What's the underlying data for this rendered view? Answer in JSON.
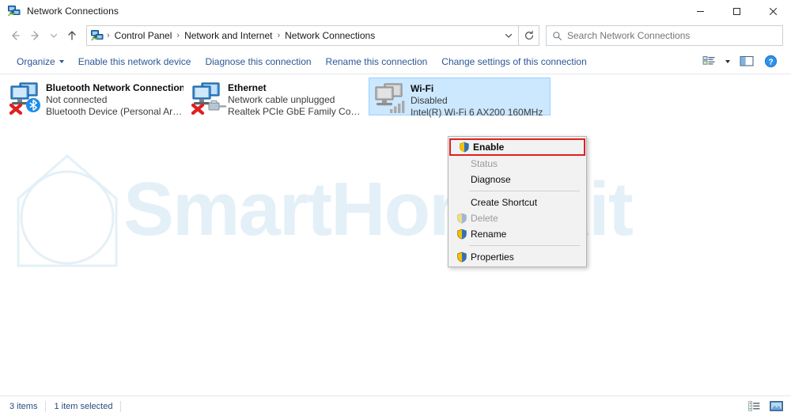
{
  "window": {
    "title": "Network Connections",
    "icon": "network-connections-icon",
    "controls": {
      "minimize": "minimize-icon",
      "maximize": "maximize-icon",
      "close": "close-icon"
    }
  },
  "nav": {
    "back": "back-arrow-icon",
    "forward": "forward-arrow-icon",
    "recent": "chevron-down-icon",
    "up": "up-arrow-icon",
    "refresh": "refresh-icon",
    "address_dropdown": "chevron-down-icon",
    "breadcrumbs": [
      {
        "label": "Control Panel"
      },
      {
        "label": "Network and Internet"
      },
      {
        "label": "Network Connections"
      }
    ],
    "separator": "›"
  },
  "search": {
    "placeholder": "Search Network Connections",
    "value": "",
    "icon": "search-icon"
  },
  "toolbar": {
    "organize": "Organize",
    "items": [
      {
        "label": "Enable this network device"
      },
      {
        "label": "Diagnose this connection"
      },
      {
        "label": "Rename this connection"
      },
      {
        "label": "Change settings of this connection"
      }
    ],
    "view_options_icon": "view-options-icon",
    "view_caret_icon": "chevron-down-icon",
    "preview_pane_icon": "preview-pane-icon",
    "help_icon": "help-icon"
  },
  "connections": [
    {
      "name": "Bluetooth Network Connection",
      "status": "Not connected",
      "device": "Bluetooth Device (Personal Area ...",
      "icon": "network-adapter-icon",
      "overlay": "bluetooth-icon",
      "error_overlay": "red-x-icon",
      "selected": false,
      "disabled": false
    },
    {
      "name": "Ethernet",
      "status": "Network cable unplugged",
      "device": "Realtek PCIe GbE Family Controller",
      "icon": "network-adapter-icon",
      "overlay": "ethernet-cable-icon",
      "error_overlay": "red-x-icon",
      "selected": false,
      "disabled": false
    },
    {
      "name": "Wi-Fi",
      "status": "Disabled",
      "device": "Intel(R) Wi-Fi 6 AX200 160MHz",
      "icon": "network-adapter-icon",
      "overlay": "wifi-signal-icon",
      "error_overlay": "",
      "selected": true,
      "disabled": true
    }
  ],
  "context_menu": {
    "items": [
      {
        "label": "Enable",
        "shield": true,
        "disabled": false,
        "highlighted": true,
        "separator_after": false
      },
      {
        "label": "Status",
        "shield": false,
        "disabled": true,
        "highlighted": false,
        "separator_after": false
      },
      {
        "label": "Diagnose",
        "shield": false,
        "disabled": false,
        "highlighted": false,
        "separator_after": true
      },
      {
        "label": "Create Shortcut",
        "shield": false,
        "disabled": false,
        "highlighted": false,
        "separator_after": false
      },
      {
        "label": "Delete",
        "shield": true,
        "disabled": true,
        "highlighted": false,
        "separator_after": false
      },
      {
        "label": "Rename",
        "shield": true,
        "disabled": false,
        "highlighted": false,
        "separator_after": true
      },
      {
        "label": "Properties",
        "shield": true,
        "disabled": false,
        "highlighted": false,
        "separator_after": false
      }
    ],
    "highlight_color": "#e02020"
  },
  "statusbar": {
    "item_count": "3 items",
    "selection": "1 item selected",
    "details_view_icon": "details-view-icon",
    "large_icons_view_icon": "large-icons-view-icon"
  },
  "watermark": {
    "text": "SmartHomeKit",
    "logo": "smart-home-logo",
    "color": "#e4f0f7"
  },
  "colors": {
    "accent_link": "#2b5797",
    "selection_bg": "#cce8ff",
    "selection_border": "#99d1ff",
    "status_text": "#2b4a7e"
  }
}
